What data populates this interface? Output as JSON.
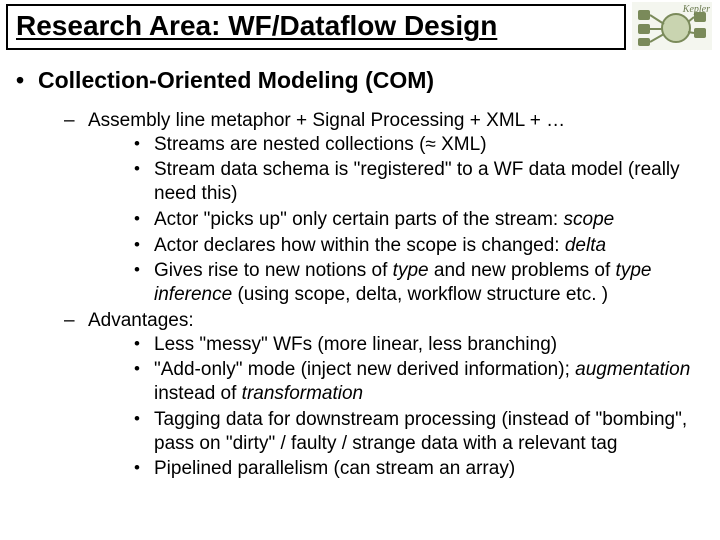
{
  "logo_label": "Kepler",
  "title": "Research Area: WF/Dataflow Design",
  "bullets": {
    "com_heading": "Collection-Oriented Modeling (COM)",
    "sub1": {
      "a": "Assembly line metaphor + Signal Processing + XML + …",
      "a_children": {
        "i": {
          "pre": "Streams are nested collections (",
          "sym": "≈",
          "post": " XML)"
        },
        "ii": "Stream data schema is \"registered\" to a WF data model (really need this)",
        "iii": {
          "pre": "Actor \"picks up\" only certain parts of the stream: ",
          "em": "scope"
        },
        "iv": {
          "pre": "Actor declares how within the scope is changed: ",
          "em": "delta"
        },
        "v": {
          "pre": "Gives rise to new notions of ",
          "em1": "type",
          "mid": " and new problems of ",
          "em2": "type inference",
          "post": " (using scope, delta, workflow structure etc. )"
        }
      },
      "b": "Advantages:",
      "b_children": {
        "i": "Less \"messy\" WFs (more linear, less branching)",
        "ii": {
          "pre": "\"Add-only\" mode (inject new derived information); ",
          "em": "augmentation",
          "mid": " instead of ",
          "em2": "transformation"
        },
        "iii": "Tagging data for downstream processing (instead of \"bombing\", pass on \"dirty\" / faulty / strange data with a relevant tag",
        "iv": "Pipelined parallelism (can stream an array)"
      }
    }
  }
}
